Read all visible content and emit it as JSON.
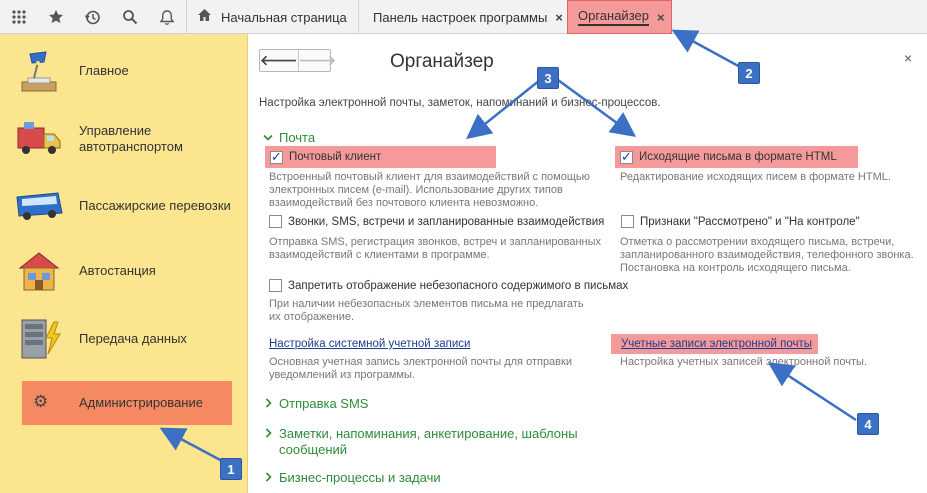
{
  "topbar": {
    "tabs": [
      {
        "label": "Начальная страница"
      },
      {
        "label": "Панель настроек программы",
        "close": "×"
      },
      {
        "label": "Органайзер",
        "close": "×"
      }
    ]
  },
  "sidebar": {
    "items": [
      {
        "label": "Главное"
      },
      {
        "label": "Управление\nавтотранспортом"
      },
      {
        "label": "Пассажирские перевозки"
      },
      {
        "label": "Автостанция"
      },
      {
        "label": "Передача данных"
      },
      {
        "label": "Администрирование"
      }
    ]
  },
  "main": {
    "title": "Органайзер",
    "close": "×",
    "description": "Настройка электронной почты, заметок, напоминаний и бизнес-процессов.",
    "sections": {
      "mail": "Почта",
      "sms": "Отправка SMS",
      "notes": "Заметки, напоминания, анкетирование, шаблоны\nсообщений",
      "bp": "Бизнес-процессы и задачи"
    },
    "options": {
      "mail_client": {
        "label": "Почтовый клиент",
        "checked": true,
        "hint": "Встроенный почтовый клиент для взаимодействий с помощью\nэлектронных писем (e-mail). Использование других типов\nвзаимодействий без почтового клиента невозможно."
      },
      "html_letters": {
        "label": "Исходящие письма в формате HTML",
        "checked": true,
        "hint": "Редактирование исходящих писем в формате HTML."
      },
      "calls": {
        "label": "Звонки, SMS, встречи и запланированные взаимодействия",
        "checked": false,
        "hint": "Отправка SMS, регистрация звонков, встреч и запланированных\nвзаимодействий с клиентами в программе."
      },
      "flags": {
        "label": "Признаки \"Рассмотрено\" и \"На контроле\"",
        "checked": false,
        "hint": "Отметка о рассмотрении входящего письма, встречи,\nзапланированного взаимодействия, телефонного звонка.\nПостановка на контроль исходящего письма."
      },
      "unsafe": {
        "label": "Запретить отображение небезопасного содержимого в письмах",
        "checked": false,
        "hint": "При наличии небезопасных элементов письма не предлагать\nих отображение."
      }
    },
    "links": {
      "system_account": {
        "label": "Настройка системной учетной записи",
        "hint": "Основная учетная запись электронной почты для отправки\nуведомлений из программы."
      },
      "accounts": {
        "label": "Учетные записи электронной почты",
        "hint": "Настройка учетных записей электронной почты."
      }
    }
  },
  "callouts": [
    "1",
    "2",
    "3",
    "4"
  ],
  "colors": {
    "sidebar": "#fbe58e",
    "active": "#f58a62",
    "highlight": "#f59a9a",
    "section": "#2e8b3a",
    "callout": "#3c70c4"
  }
}
